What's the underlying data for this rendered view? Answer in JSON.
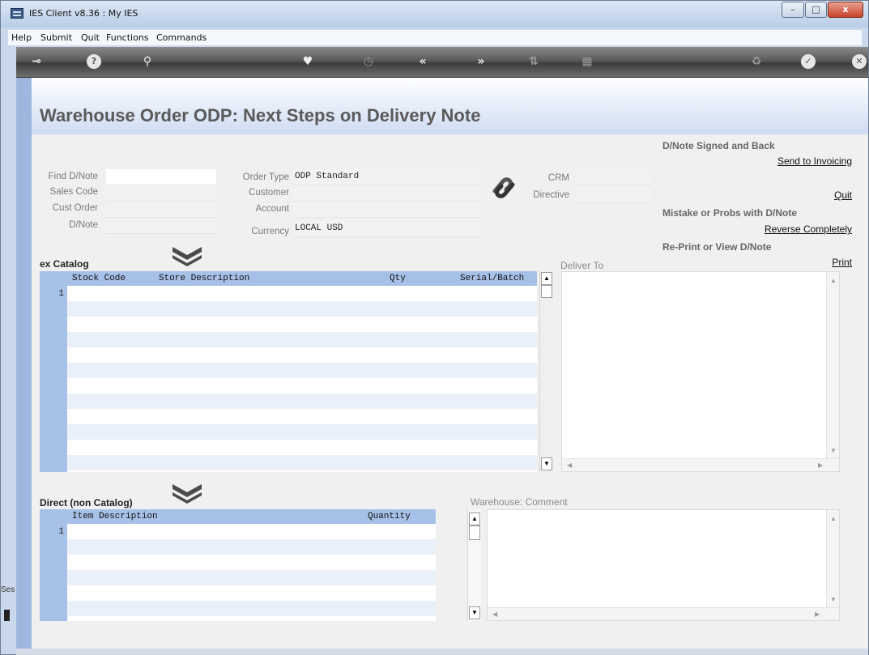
{
  "window": {
    "title": "IES Client v8.36 : My IES",
    "controls": {
      "minimize": "–",
      "maximize": "□",
      "close": "x"
    }
  },
  "menu": [
    "Help",
    "Submit",
    "Quit",
    "Functions",
    "Commands"
  ],
  "toolbar": {
    "icons": [
      "key-icon",
      "help-icon",
      "search-icon",
      "heart-icon",
      "clock-icon",
      "rewind-icon",
      "forward-icon",
      "sort-icon",
      "calculator-icon",
      "recycle-icon",
      "check-icon",
      "close-icon"
    ]
  },
  "page": {
    "title": "Warehouse Order ODP: Next Steps on Delivery Note"
  },
  "fields": {
    "find_dnote": {
      "label": "Find D/Note",
      "value": ""
    },
    "sales_code": {
      "label": "Sales Code",
      "value": ""
    },
    "cust_order": {
      "label": "Cust Order",
      "value": ""
    },
    "dnote": {
      "label": "D/Note",
      "value": ""
    },
    "order_type": {
      "label": "Order Type",
      "value": "ODP Standard"
    },
    "customer": {
      "label": "Customer",
      "value": ""
    },
    "account": {
      "label": "Account",
      "value": ""
    },
    "currency": {
      "label": "Currency",
      "value": "LOCAL USD"
    },
    "crm": {
      "label": "CRM",
      "value": ""
    },
    "directive": {
      "label": "Directive",
      "value": ""
    }
  },
  "actions": {
    "signed_heading": "D/Note Signed and Back",
    "send_to_invoicing": "Send to Invoicing",
    "quit": "Quit",
    "mistake_heading": "Mistake or Probs with D/Note",
    "reverse_completely": "Reverse Completely",
    "reprint_heading": "Re-Print or View D/Note",
    "print": "Print"
  },
  "ex_catalog": {
    "title": "ex Catalog",
    "columns": [
      "Stock Code",
      "Store Description",
      "Qty",
      "Serial/Batch"
    ],
    "rows": [
      "1"
    ]
  },
  "deliver_to": {
    "label": "Deliver To",
    "value": ""
  },
  "direct": {
    "title": "Direct (non Catalog)",
    "columns": [
      "Item Description",
      "Quantity"
    ],
    "rows": [
      "1"
    ]
  },
  "warehouse_comment": {
    "label": "Warehouse: Comment",
    "value": ""
  },
  "sidebar": {
    "session_tab": "Ses"
  }
}
